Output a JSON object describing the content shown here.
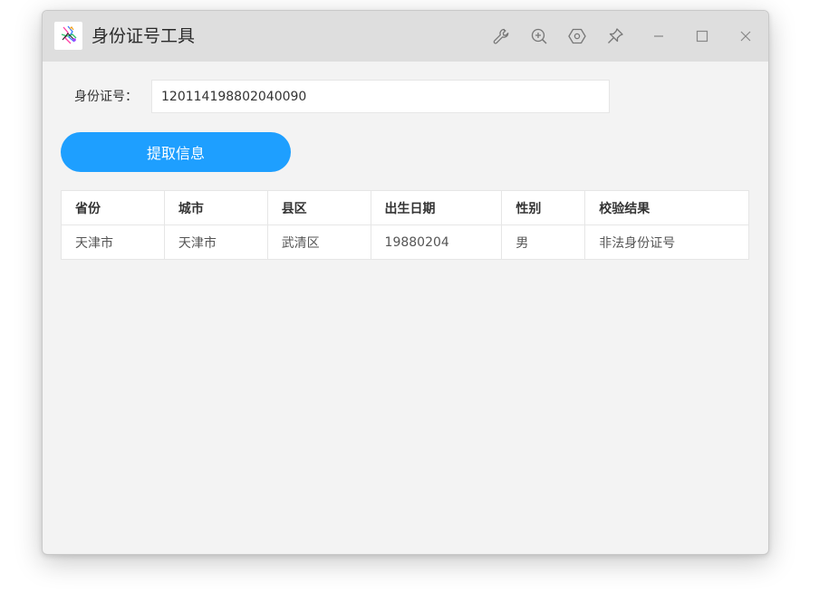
{
  "window": {
    "title": "身份证号工具",
    "icons": [
      "wrench-icon",
      "zoom-in-icon",
      "hexagon-settings-icon",
      "pin-icon",
      "minimize-icon",
      "maximize-icon",
      "close-icon"
    ]
  },
  "form": {
    "id_label": "身份证号：",
    "id_value": "120114198802040090",
    "extract_label": "提取信息"
  },
  "table": {
    "headers": [
      "省份",
      "城市",
      "县区",
      "出生日期",
      "性别",
      "校验结果"
    ],
    "rows": [
      [
        "天津市",
        "天津市",
        "武清区",
        "19880204",
        "男",
        "非法身份证号"
      ]
    ]
  },
  "colors": {
    "accent": "#1e9fff",
    "titlebar": "#dedede",
    "window_bg": "#f3f3f3"
  }
}
